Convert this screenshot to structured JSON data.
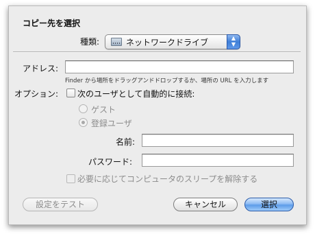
{
  "dialog": {
    "title": "コピー先を選択",
    "kind_label": "種類:",
    "kind_value": "ネットワークドライブ",
    "kind_icon": "network-drive-icon",
    "address_label": "アドレス:",
    "address_value": "",
    "address_hint": "Finder から場所をドラッグアンドドロップするか、場所の URL を入力します",
    "options_label": "オプション:",
    "connect_auto_label": "次のユーザとして自動的に接続:",
    "connect_auto_checked": false,
    "guest_label": "ゲスト",
    "registered_user_label": "登録ユーザ",
    "registered_user_selected": true,
    "name_label": "名前:",
    "name_value": "",
    "password_label": "パスワード:",
    "password_value": "",
    "wake_label": "必要に応じてコンピュータのスリープを解除する",
    "wake_checked": false,
    "test_button": "設定をテスト",
    "cancel_button": "キャンセル",
    "select_button": "選択"
  }
}
